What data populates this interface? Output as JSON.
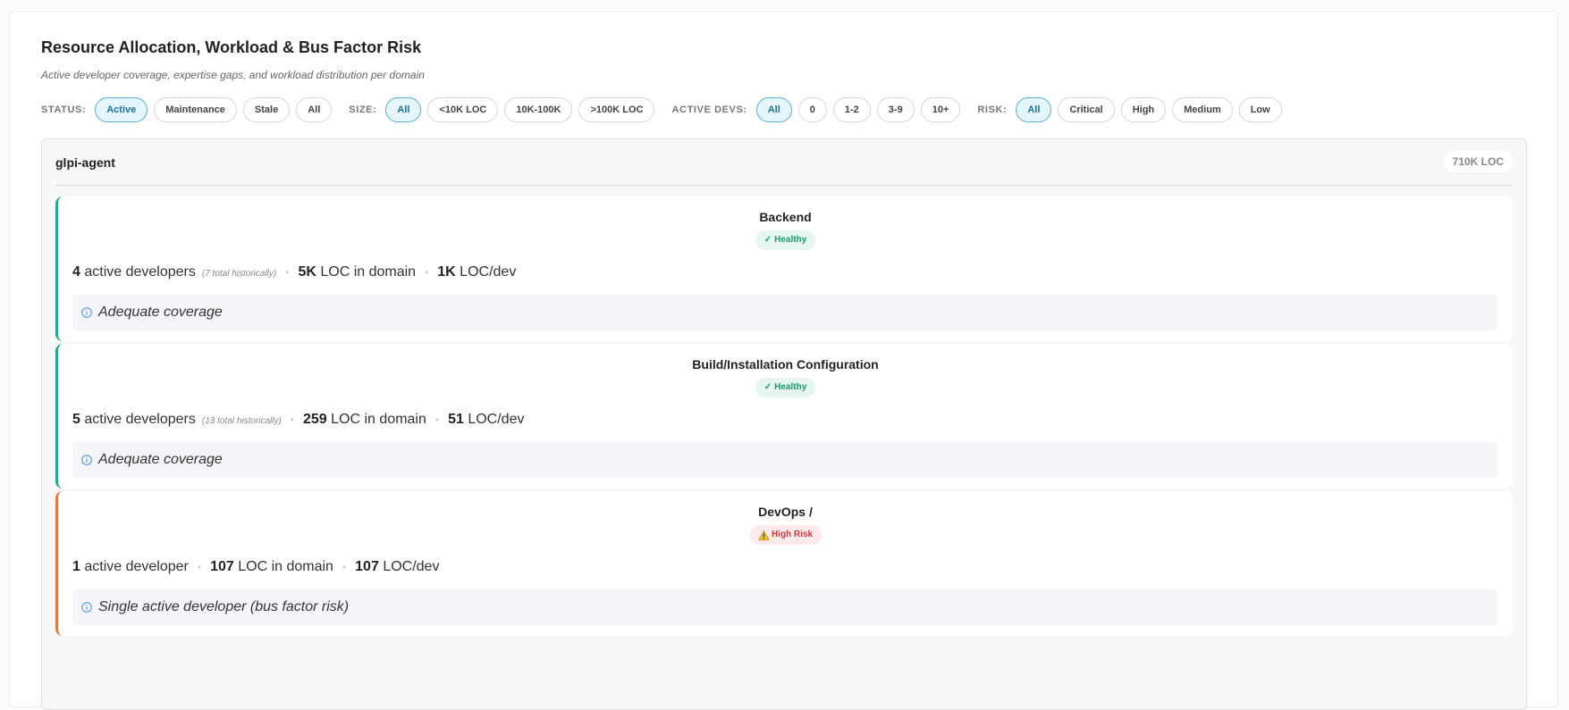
{
  "header": {
    "title": "Resource Allocation, Workload & Bus Factor Risk",
    "subtitle": "Active developer coverage, expertise gaps, and workload distribution per domain"
  },
  "filters": {
    "status": {
      "label": "STATUS:",
      "options": [
        "Active",
        "Maintenance",
        "Stale",
        "All"
      ],
      "selected": "Active"
    },
    "size": {
      "label": "SIZE:",
      "options": [
        "All",
        "<10K LOC",
        "10K-100K",
        ">100K LOC"
      ],
      "selected": "All"
    },
    "active_devs": {
      "label": "ACTIVE DEVS:",
      "options": [
        "All",
        "0",
        "1-2",
        "3-9",
        "10+"
      ],
      "selected": "All"
    },
    "risk": {
      "label": "RISK:",
      "options": [
        "All",
        "Critical",
        "High",
        "Medium",
        "Low"
      ],
      "selected": "All"
    }
  },
  "repo": {
    "name": "glpi-agent",
    "loc": "710K LOC",
    "domains": [
      {
        "name": "Backend",
        "status": "Healthy",
        "status_icon": "check-icon",
        "status_color": "#1e9a6c",
        "devs_count": "4",
        "devs_label": "active developers",
        "historical": "(7 total historically)",
        "loc": "5K",
        "loc_label": "LOC in domain",
        "loc_per_dev": "1K",
        "loc_per_dev_label": "LOC/dev",
        "note": "Adequate coverage"
      },
      {
        "name": "Build/Installation Configuration",
        "status": "Healthy",
        "status_icon": "check-icon",
        "status_color": "#1e9a6c",
        "devs_count": "5",
        "devs_label": "active developers",
        "historical": "(13 total historically)",
        "loc": "259",
        "loc_label": "LOC in domain",
        "loc_per_dev": "51",
        "loc_per_dev_label": "LOC/dev",
        "note": "Adequate coverage"
      },
      {
        "name": "DevOps /",
        "status": "High Risk",
        "status_icon": "warning-icon",
        "status_color": "#d13a3a",
        "devs_count": "1",
        "devs_label": "active developer",
        "loc": "107",
        "loc_label": "LOC in domain",
        "loc_per_dev": "107",
        "loc_per_dev_label": "LOC/dev",
        "note": "Single active developer (bus factor risk)"
      }
    ]
  },
  "colors": {
    "healthy_border": "#26a98a",
    "high_risk_border": "#e07a3c",
    "chip_active_bg": "#e4f5fb",
    "chip_active_border": "#5aaed0",
    "info_icon": "#4a90d9"
  }
}
